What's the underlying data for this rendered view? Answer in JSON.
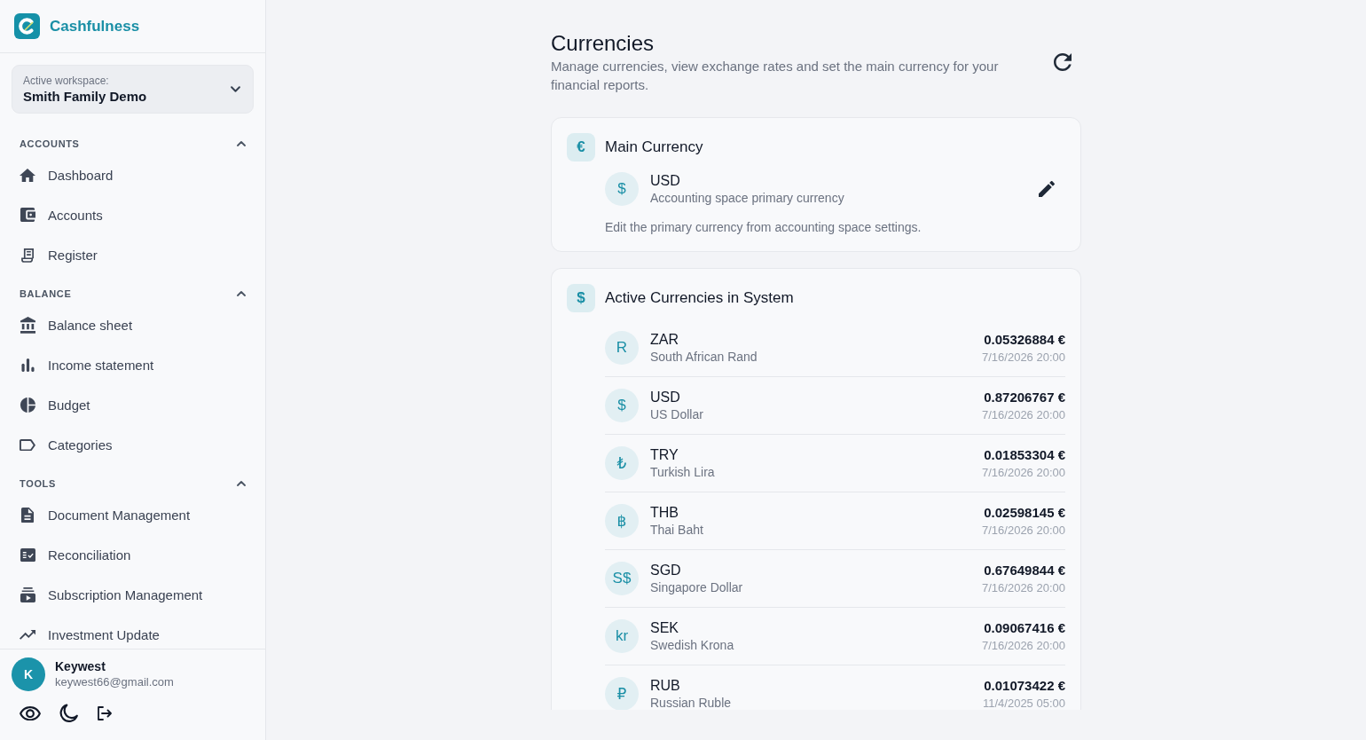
{
  "sidebar": {
    "brand": "Cashfulness",
    "workspace": {
      "label": "Active workspace:",
      "name": "Smith Family Demo"
    },
    "sections": [
      {
        "title": "ACCOUNTS",
        "expanded": true,
        "items": [
          {
            "label": "Dashboard",
            "selected": false
          },
          {
            "label": "Accounts",
            "selected": false
          },
          {
            "label": "Register",
            "selected": false
          }
        ]
      },
      {
        "title": "BALANCE",
        "expanded": true,
        "items": [
          {
            "label": "Balance sheet",
            "selected": false
          },
          {
            "label": "Income statement",
            "selected": false
          },
          {
            "label": "Budget",
            "selected": false
          },
          {
            "label": "Categories",
            "selected": false
          }
        ]
      },
      {
        "title": "TOOLS",
        "expanded": true,
        "items": [
          {
            "label": "Document Management",
            "selected": false
          },
          {
            "label": "Reconciliation",
            "selected": false
          },
          {
            "label": "Subscription Management",
            "selected": false
          },
          {
            "label": "Investment Update",
            "selected": false
          }
        ]
      }
    ],
    "user": {
      "initial": "K",
      "name": "Keywest",
      "email": "keywest66@gmail.com"
    }
  },
  "page": {
    "title": "Currencies",
    "subtitle": "Manage currencies, view exchange rates and set the main currency for your financial reports."
  },
  "main_currency": {
    "symbol": "€",
    "title": "Main Currency",
    "currency": {
      "symbol": "$",
      "code": "USD",
      "description": "Accounting space primary currency"
    },
    "note": "Edit the primary currency from accounting space settings."
  },
  "active_currencies": {
    "symbol": "$",
    "title": "Active Currencies in System",
    "rows": [
      {
        "symbol": "R",
        "code": "ZAR",
        "name": "South African Rand",
        "rate": "0.05326884 €",
        "updated": "7/16/2026 20:00"
      },
      {
        "symbol": "$",
        "code": "USD",
        "name": "US Dollar",
        "rate": "0.87206767 €",
        "updated": "7/16/2026 20:00"
      },
      {
        "symbol": "₺",
        "code": "TRY",
        "name": "Turkish Lira",
        "rate": "0.01853304 €",
        "updated": "7/16/2026 20:00"
      },
      {
        "symbol": "฿",
        "code": "THB",
        "name": "Thai Baht",
        "rate": "0.02598145 €",
        "updated": "7/16/2026 20:00"
      },
      {
        "symbol": "S$",
        "code": "SGD",
        "name": "Singapore Dollar",
        "rate": "0.67649844 €",
        "updated": "7/16/2026 20:00"
      },
      {
        "symbol": "kr",
        "code": "SEK",
        "name": "Swedish Krona",
        "rate": "0.09067416 €",
        "updated": "7/16/2026 20:00"
      },
      {
        "symbol": "₽",
        "code": "RUB",
        "name": "Russian Ruble",
        "rate": "0.01073422 €",
        "updated": "11/4/2025 05:00"
      }
    ]
  }
}
